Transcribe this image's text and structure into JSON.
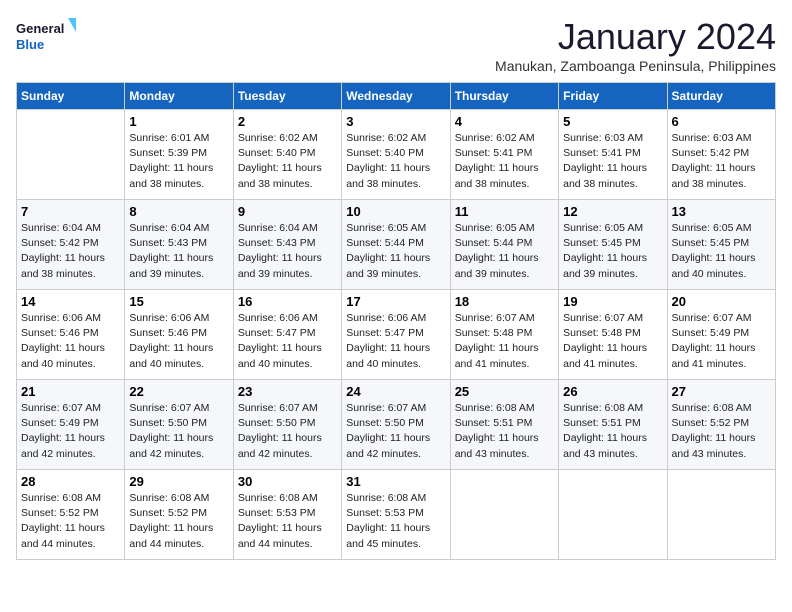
{
  "logo": {
    "line1": "General",
    "line2": "Blue"
  },
  "title": "January 2024",
  "subtitle": "Manukan, Zamboanga Peninsula, Philippines",
  "days_of_week": [
    "Sunday",
    "Monday",
    "Tuesday",
    "Wednesday",
    "Thursday",
    "Friday",
    "Saturday"
  ],
  "weeks": [
    [
      {
        "day": "",
        "sunrise": "",
        "sunset": "",
        "daylight": ""
      },
      {
        "day": "1",
        "sunrise": "Sunrise: 6:01 AM",
        "sunset": "Sunset: 5:39 PM",
        "daylight": "Daylight: 11 hours and 38 minutes."
      },
      {
        "day": "2",
        "sunrise": "Sunrise: 6:02 AM",
        "sunset": "Sunset: 5:40 PM",
        "daylight": "Daylight: 11 hours and 38 minutes."
      },
      {
        "day": "3",
        "sunrise": "Sunrise: 6:02 AM",
        "sunset": "Sunset: 5:40 PM",
        "daylight": "Daylight: 11 hours and 38 minutes."
      },
      {
        "day": "4",
        "sunrise": "Sunrise: 6:02 AM",
        "sunset": "Sunset: 5:41 PM",
        "daylight": "Daylight: 11 hours and 38 minutes."
      },
      {
        "day": "5",
        "sunrise": "Sunrise: 6:03 AM",
        "sunset": "Sunset: 5:41 PM",
        "daylight": "Daylight: 11 hours and 38 minutes."
      },
      {
        "day": "6",
        "sunrise": "Sunrise: 6:03 AM",
        "sunset": "Sunset: 5:42 PM",
        "daylight": "Daylight: 11 hours and 38 minutes."
      }
    ],
    [
      {
        "day": "7",
        "sunrise": "Sunrise: 6:04 AM",
        "sunset": "Sunset: 5:42 PM",
        "daylight": "Daylight: 11 hours and 38 minutes."
      },
      {
        "day": "8",
        "sunrise": "Sunrise: 6:04 AM",
        "sunset": "Sunset: 5:43 PM",
        "daylight": "Daylight: 11 hours and 39 minutes."
      },
      {
        "day": "9",
        "sunrise": "Sunrise: 6:04 AM",
        "sunset": "Sunset: 5:43 PM",
        "daylight": "Daylight: 11 hours and 39 minutes."
      },
      {
        "day": "10",
        "sunrise": "Sunrise: 6:05 AM",
        "sunset": "Sunset: 5:44 PM",
        "daylight": "Daylight: 11 hours and 39 minutes."
      },
      {
        "day": "11",
        "sunrise": "Sunrise: 6:05 AM",
        "sunset": "Sunset: 5:44 PM",
        "daylight": "Daylight: 11 hours and 39 minutes."
      },
      {
        "day": "12",
        "sunrise": "Sunrise: 6:05 AM",
        "sunset": "Sunset: 5:45 PM",
        "daylight": "Daylight: 11 hours and 39 minutes."
      },
      {
        "day": "13",
        "sunrise": "Sunrise: 6:05 AM",
        "sunset": "Sunset: 5:45 PM",
        "daylight": "Daylight: 11 hours and 40 minutes."
      }
    ],
    [
      {
        "day": "14",
        "sunrise": "Sunrise: 6:06 AM",
        "sunset": "Sunset: 5:46 PM",
        "daylight": "Daylight: 11 hours and 40 minutes."
      },
      {
        "day": "15",
        "sunrise": "Sunrise: 6:06 AM",
        "sunset": "Sunset: 5:46 PM",
        "daylight": "Daylight: 11 hours and 40 minutes."
      },
      {
        "day": "16",
        "sunrise": "Sunrise: 6:06 AM",
        "sunset": "Sunset: 5:47 PM",
        "daylight": "Daylight: 11 hours and 40 minutes."
      },
      {
        "day": "17",
        "sunrise": "Sunrise: 6:06 AM",
        "sunset": "Sunset: 5:47 PM",
        "daylight": "Daylight: 11 hours and 40 minutes."
      },
      {
        "day": "18",
        "sunrise": "Sunrise: 6:07 AM",
        "sunset": "Sunset: 5:48 PM",
        "daylight": "Daylight: 11 hours and 41 minutes."
      },
      {
        "day": "19",
        "sunrise": "Sunrise: 6:07 AM",
        "sunset": "Sunset: 5:48 PM",
        "daylight": "Daylight: 11 hours and 41 minutes."
      },
      {
        "day": "20",
        "sunrise": "Sunrise: 6:07 AM",
        "sunset": "Sunset: 5:49 PM",
        "daylight": "Daylight: 11 hours and 41 minutes."
      }
    ],
    [
      {
        "day": "21",
        "sunrise": "Sunrise: 6:07 AM",
        "sunset": "Sunset: 5:49 PM",
        "daylight": "Daylight: 11 hours and 42 minutes."
      },
      {
        "day": "22",
        "sunrise": "Sunrise: 6:07 AM",
        "sunset": "Sunset: 5:50 PM",
        "daylight": "Daylight: 11 hours and 42 minutes."
      },
      {
        "day": "23",
        "sunrise": "Sunrise: 6:07 AM",
        "sunset": "Sunset: 5:50 PM",
        "daylight": "Daylight: 11 hours and 42 minutes."
      },
      {
        "day": "24",
        "sunrise": "Sunrise: 6:07 AM",
        "sunset": "Sunset: 5:50 PM",
        "daylight": "Daylight: 11 hours and 42 minutes."
      },
      {
        "day": "25",
        "sunrise": "Sunrise: 6:08 AM",
        "sunset": "Sunset: 5:51 PM",
        "daylight": "Daylight: 11 hours and 43 minutes."
      },
      {
        "day": "26",
        "sunrise": "Sunrise: 6:08 AM",
        "sunset": "Sunset: 5:51 PM",
        "daylight": "Daylight: 11 hours and 43 minutes."
      },
      {
        "day": "27",
        "sunrise": "Sunrise: 6:08 AM",
        "sunset": "Sunset: 5:52 PM",
        "daylight": "Daylight: 11 hours and 43 minutes."
      }
    ],
    [
      {
        "day": "28",
        "sunrise": "Sunrise: 6:08 AM",
        "sunset": "Sunset: 5:52 PM",
        "daylight": "Daylight: 11 hours and 44 minutes."
      },
      {
        "day": "29",
        "sunrise": "Sunrise: 6:08 AM",
        "sunset": "Sunset: 5:52 PM",
        "daylight": "Daylight: 11 hours and 44 minutes."
      },
      {
        "day": "30",
        "sunrise": "Sunrise: 6:08 AM",
        "sunset": "Sunset: 5:53 PM",
        "daylight": "Daylight: 11 hours and 44 minutes."
      },
      {
        "day": "31",
        "sunrise": "Sunrise: 6:08 AM",
        "sunset": "Sunset: 5:53 PM",
        "daylight": "Daylight: 11 hours and 45 minutes."
      },
      {
        "day": "",
        "sunrise": "",
        "sunset": "",
        "daylight": ""
      },
      {
        "day": "",
        "sunrise": "",
        "sunset": "",
        "daylight": ""
      },
      {
        "day": "",
        "sunrise": "",
        "sunset": "",
        "daylight": ""
      }
    ]
  ]
}
